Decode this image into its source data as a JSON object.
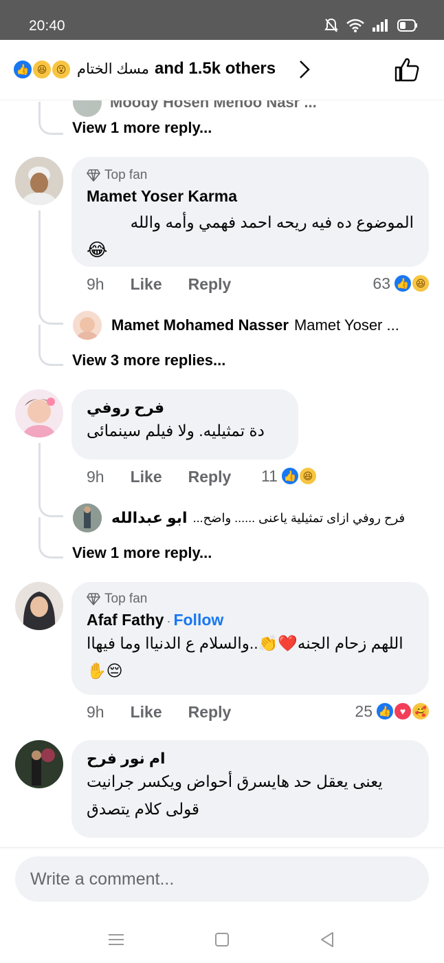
{
  "status_bar": {
    "time": "20:40"
  },
  "reactions_header": {
    "name": "مسك الختام",
    "others": "and 1.5k others"
  },
  "top_partial": {
    "snippet": "Moody Hosen Mehoo Nasr ..."
  },
  "threads": [
    {
      "view_more": "View 1 more reply..."
    }
  ],
  "comments": [
    {
      "badge": "Top fan",
      "author": "Mamet Yoser Karma",
      "text": "الموضوع ده فيه ريحه احمد فهمي وأمه والله",
      "emoji": "😂",
      "time": "9h",
      "like": "Like",
      "reply": "Reply",
      "reaction_count": "63",
      "reply_preview_name": "Mamet Mohamed Nasser",
      "reply_preview_text": "Mamet Yoser ...",
      "view_more": "View 3 more replies..."
    },
    {
      "author": "فرح روفي",
      "text": "دة تمثيليه. ولا فيلم سينمائى",
      "time": "9h",
      "like": "Like",
      "reply": "Reply",
      "reaction_count": "11",
      "reply_preview_name": "ابو عبدالله",
      "reply_preview_text": "فرح روفي ازاى تمثيلية ياعنى ...... واضح...",
      "view_more": "View 1 more reply..."
    },
    {
      "badge": "Top fan",
      "author": "Afaf Fathy",
      "follow": "Follow",
      "text": "اللهم زحام الجنه❤️👏..والسلام ع الدنياا وما فيهاا 😔✋",
      "time": "9h",
      "like": "Like",
      "reply": "Reply",
      "reaction_count": "25"
    },
    {
      "author": "ام نور فرح",
      "text": "يعنى يعقل حد هايسرق أحواض ويكسر جرانيت قولى كلام يتصدق"
    }
  ],
  "composer": {
    "placeholder": "Write a comment..."
  },
  "colors": {
    "accent": "#1877f2",
    "bubble": "#f0f2f5",
    "muted": "#65676b"
  }
}
